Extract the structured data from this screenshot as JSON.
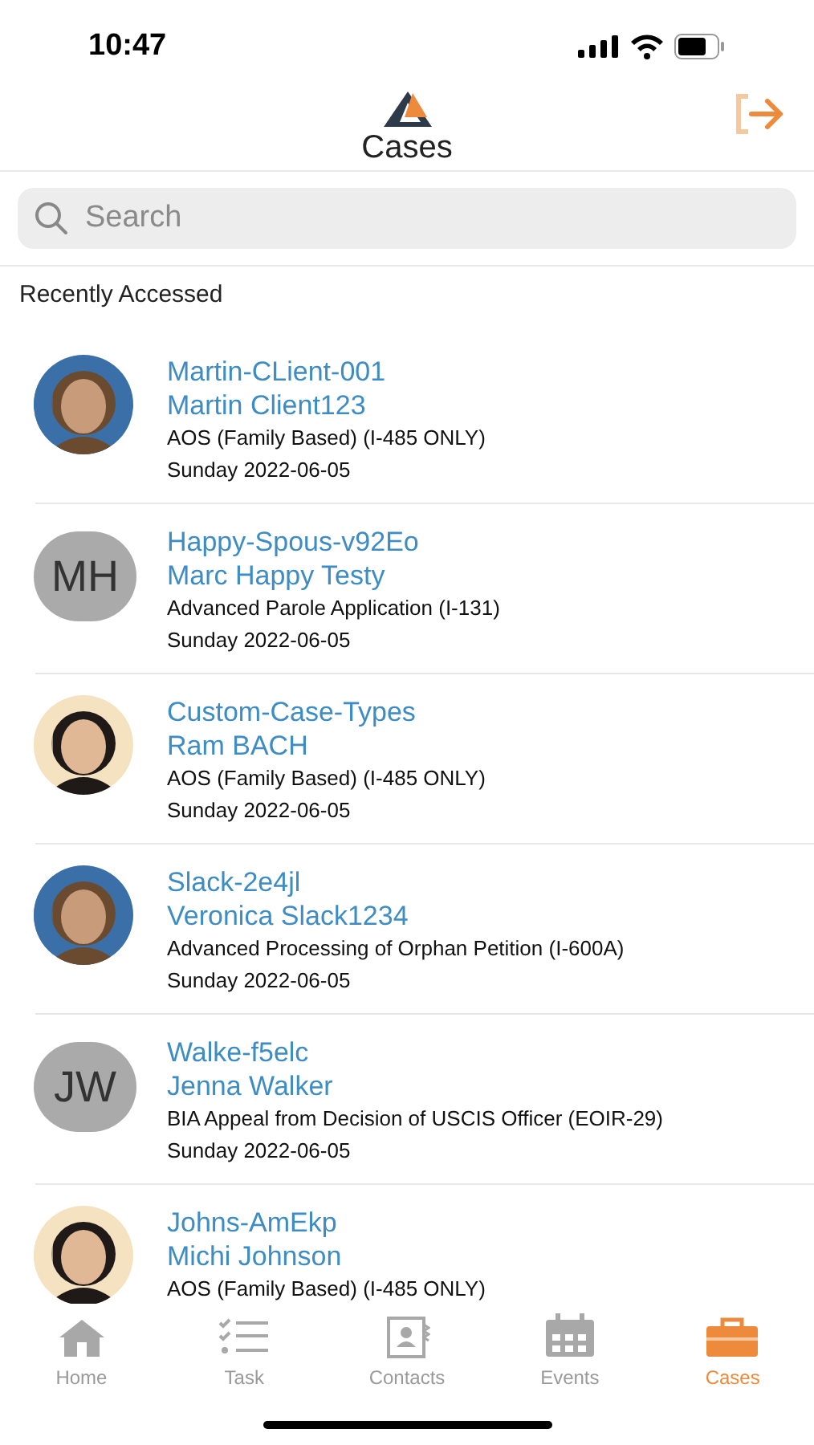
{
  "status_bar": {
    "time": "10:47"
  },
  "header": {
    "title": "Cases"
  },
  "search": {
    "placeholder": "Search"
  },
  "section_title": "Recently Accessed",
  "cases": [
    {
      "case_id": "Martin-CLient-001",
      "client": "Martin Client123",
      "case_type": "AOS (Family Based) (I-485 ONLY)",
      "date": "Sunday 2022-06-05"
    },
    {
      "case_id": "Happy-Spous-v92Eo",
      "client": "Marc Happy Testy",
      "case_type": "Advanced Parole Application (I-131)",
      "date": "Sunday 2022-06-05",
      "avatar": {
        "kind": "initials",
        "initials": "MH"
      }
    },
    {
      "case_id": "Custom-Case-Types",
      "client": "Ram BACH",
      "case_type": "AOS (Family Based) (I-485 ONLY)",
      "date": "Sunday 2022-06-05"
    },
    {
      "case_id": "Slack-2e4jl",
      "client": "Veronica Slack1234",
      "case_type": "Advanced Processing of Orphan Petition (I-600A)",
      "date": "Sunday 2022-06-05"
    },
    {
      "case_id": "Walke-f5elc",
      "client": "Jenna Walker",
      "case_type": "BIA Appeal from Decision of USCIS Officer (EOIR-29)",
      "date": "Sunday 2022-06-05",
      "avatar": {
        "kind": "initials",
        "initials": "JW"
      }
    },
    {
      "case_id": "Johns-AmEkp",
      "client": "Michi Johnson",
      "case_type": "AOS (Family Based) (I-485 ONLY)"
    }
  ],
  "tabs": [
    {
      "label": "Home",
      "kind": "home",
      "selected": false
    },
    {
      "label": "Task",
      "kind": "task",
      "selected": false
    },
    {
      "label": "Contacts",
      "kind": "contacts",
      "selected": false
    },
    {
      "label": "Events",
      "kind": "events",
      "selected": false
    },
    {
      "label": "Cases",
      "kind": "cases",
      "selected": true
    }
  ]
}
